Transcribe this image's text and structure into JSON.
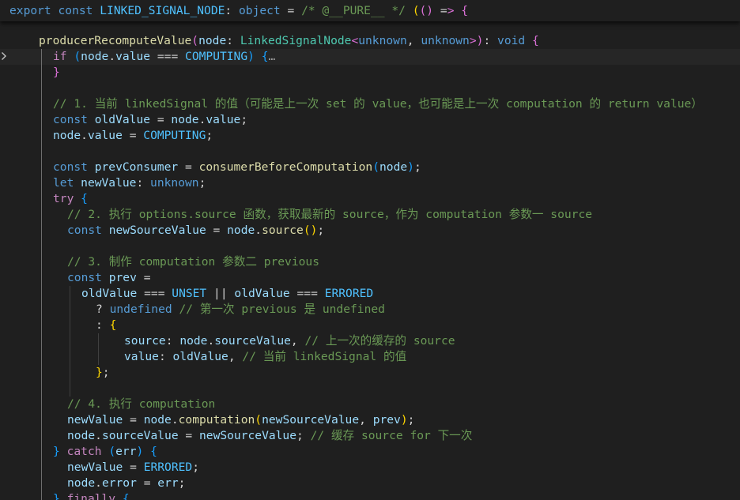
{
  "editor": {
    "sticky_header": "export const LINKED_SIGNAL_NODE: object = /* @__PURE__ */ (() => {",
    "fold_ellipsis": "…",
    "lines": [
      "producerRecomputeValue(node: LinkedSignalNode<unknown, unknown>): void {",
      "if (node.value === COMPUTING) {…",
      "}",
      "",
      "// 1. 当前 linkedSignal 的值（可能是上一次 set 的 value，也可能是上一次 computation 的 return value）",
      "const oldValue = node.value;",
      "node.value = COMPUTING;",
      "",
      "const prevConsumer = consumerBeforeComputation(node);",
      "let newValue: unknown;",
      "try {",
      "// 2. 执行 options.source 函数，获取最新的 source，作为 computation 参数一 source",
      "const newSourceValue = node.source();",
      "",
      "// 3. 制作 computation 参数二 previous",
      "const prev =",
      "oldValue === UNSET || oldValue === ERRORED",
      "? undefined // 第一次 previous 是 undefined",
      ": {",
      "source: node.sourceValue, // 上一次的缓存的 source",
      "value: oldValue, // 当前 linkedSignal 的值",
      "};",
      "",
      "// 4. 执行 computation",
      "newValue = node.computation(newSourceValue, prev);",
      "node.sourceValue = newSourceValue; // 缓存 source for 下一次",
      "} catch (err) {",
      "newValue = ERRORED;",
      "node.error = err;",
      "} finally {"
    ]
  },
  "colors": {
    "background": "#1f1f1f",
    "keyword": "#569cd6",
    "control": "#c586c0",
    "variable": "#9cdcfe",
    "constant": "#4fc1ff",
    "function": "#dcdcaa",
    "type": "#4ec9b0",
    "comment": "#6a9955",
    "bracket_1": "#ffd700",
    "bracket_2": "#da70d6",
    "bracket_3": "#179fff"
  },
  "icons": {
    "fold": "chevron-right-icon"
  }
}
